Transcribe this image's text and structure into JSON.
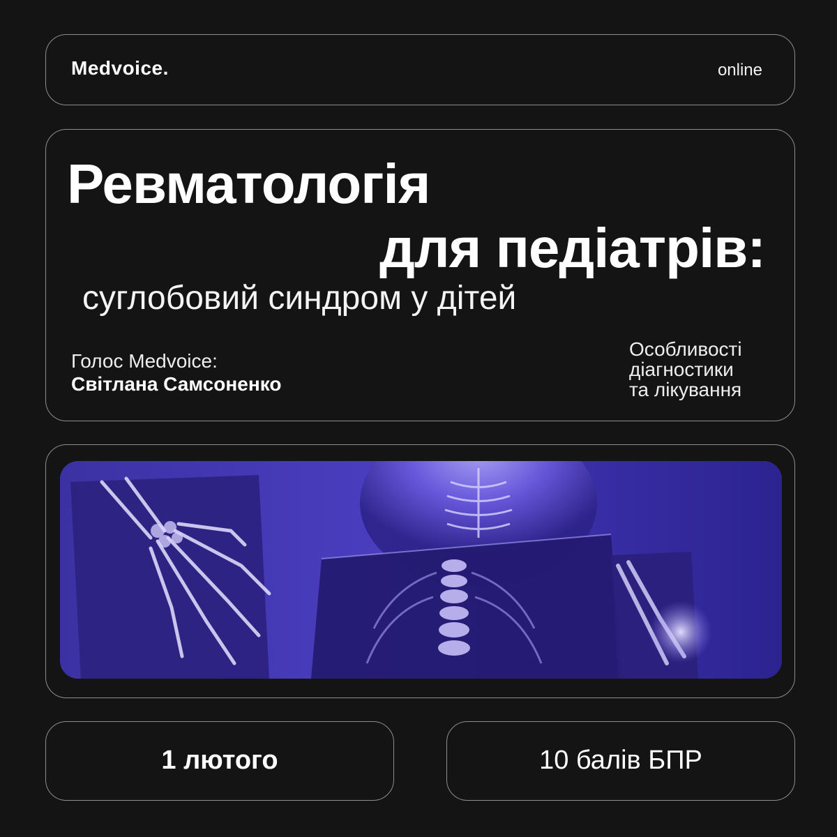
{
  "header": {
    "logo": "Medvoice.",
    "format": "online"
  },
  "title": {
    "line1": "Ревматологія",
    "line2": "для педіатрів:",
    "subtitle": "суглобовий синдром у дітей"
  },
  "speaker": {
    "label": "Голос Medvoice:",
    "name": "Світлана Самсоненко"
  },
  "features": [
    "Особливості",
    "діагностики",
    "та лікування"
  ],
  "event": {
    "date": "1 лютого",
    "points": "10 балів БПР"
  },
  "colors": {
    "background": "#141414",
    "border": "#8e8e8e",
    "image_tint": "#5a4ac8"
  }
}
